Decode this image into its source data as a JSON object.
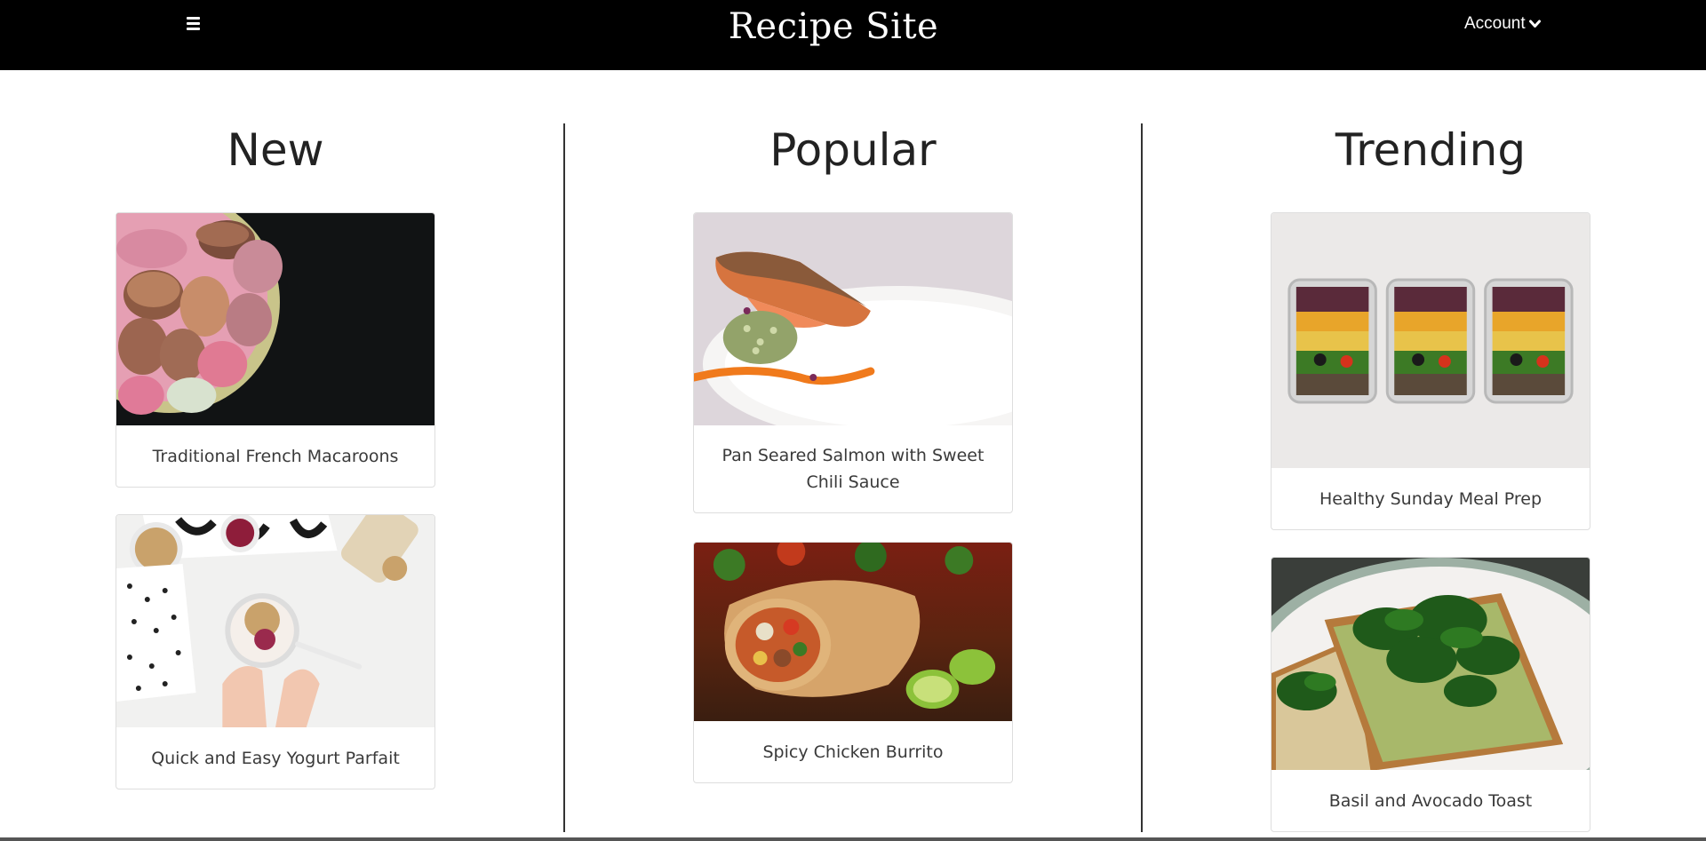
{
  "header": {
    "site_title": "Recipe Site",
    "account_label": "Account"
  },
  "columns": [
    {
      "heading": "New",
      "cards": [
        {
          "title": "Traditional French Macaroons",
          "image": "macarons-photo"
        },
        {
          "title": "Quick and Easy Yogurt Parfait",
          "image": "yogurt-parfait-photo"
        }
      ]
    },
    {
      "heading": "Popular",
      "cards": [
        {
          "title": "Pan Seared Salmon with Sweet Chili Sauce",
          "image": "salmon-photo"
        },
        {
          "title": "Spicy Chicken Burrito",
          "image": "burrito-photo"
        }
      ]
    },
    {
      "heading": "Trending",
      "cards": [
        {
          "title": "Healthy Sunday Meal Prep",
          "image": "meal-prep-photo"
        },
        {
          "title": "Basil and Avocado Toast",
          "image": "avocado-toast-photo"
        }
      ]
    }
  ],
  "colors": {
    "navbar_bg": "#000000",
    "nav_text": "#ffffff",
    "divider": "#333333",
    "card_border": "#dedede"
  },
  "icons": {
    "menu": "hamburger-menu-icon",
    "account_caret": "chevron-down-icon"
  }
}
